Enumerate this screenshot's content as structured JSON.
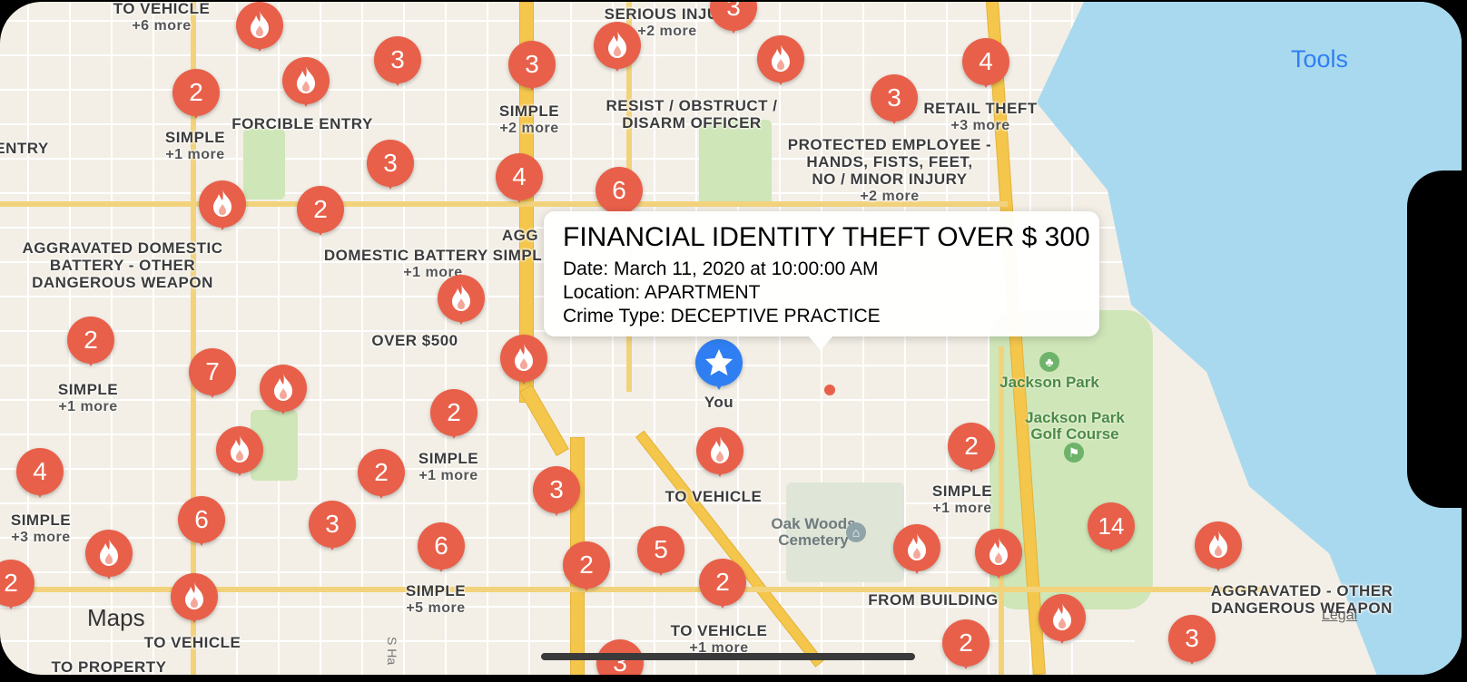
{
  "ui": {
    "tools_label": "Tools",
    "maps_logo": "Maps",
    "legal_label": "Legal"
  },
  "callout": {
    "title": "FINANCIAL IDENTITY THEFT OVER $ 300",
    "date": "Date: March 11, 2020 at 10:00:00 AM",
    "location": "Location: APARTMENT",
    "crime_type": "Crime Type: DECEPTIVE PRACTICE"
  },
  "user_location": {
    "label": "You"
  },
  "places": {
    "jackson_park": "Jackson Park",
    "golf_course": "Jackson Park\nGolf Course",
    "cemetery": "Oak Woods\nCemetery",
    "street_fragment": "S Ha"
  },
  "labels": [
    {
      "text": "TO VEHICLE",
      "more": "+6 more"
    },
    {
      "text": "SERIOUS INJUR",
      "more": "+2 more"
    },
    {
      "text": "SIMPLE",
      "more": "+1 more"
    },
    {
      "text": "FORCIBLE ENTRY",
      "more": ""
    },
    {
      "text": "SIMPLE",
      "more": "+2 more"
    },
    {
      "text": "RESIST / OBSTRUCT /\nDISARM OFFICER",
      "more": ""
    },
    {
      "text": "RETAIL THEFT",
      "more": "+3 more"
    },
    {
      "text": "PROTECTED EMPLOYEE -\nHANDS, FISTS, FEET,\nNO / MINOR INJURY",
      "more": "+2 more"
    },
    {
      "text": "ENTRY",
      "more": ""
    },
    {
      "text": "AGGRAVATED DOMESTIC\nBATTERY - OTHER\nDANGEROUS WEAPON",
      "more": ""
    },
    {
      "text": "DOMESTIC BATTERY SIMPL",
      "more": "+1 more"
    },
    {
      "text": "AGG",
      "more": ""
    },
    {
      "text": "OVER $500",
      "more": ""
    },
    {
      "text": "SIMPLE",
      "more": "+1 more"
    },
    {
      "text": "SIMPLE",
      "more": "+1 more"
    },
    {
      "text": "TO VEHICLE",
      "more": ""
    },
    {
      "text": "SIMPLE",
      "more": "+1 more"
    },
    {
      "text": "SIMPLE",
      "more": "+3 more"
    },
    {
      "text": "SIMPLE",
      "more": "+5 more"
    },
    {
      "text": "FROM BUILDING",
      "more": ""
    },
    {
      "text": "AGGRAVATED - OTHER\nDANGEROUS WEAPON",
      "more": ""
    },
    {
      "text": "TO VEHICLE",
      "more": ""
    },
    {
      "text": "TO VEHICLE",
      "more": "+1 more"
    },
    {
      "text": "TO PROPERTY",
      "more": ""
    }
  ],
  "pins": [
    {
      "kind": "flame"
    },
    {
      "kind": "count",
      "count": "3"
    },
    {
      "kind": "count",
      "count": "2"
    },
    {
      "kind": "flame"
    },
    {
      "kind": "count",
      "count": "3"
    },
    {
      "kind": "count",
      "count": "3"
    },
    {
      "kind": "flame"
    },
    {
      "kind": "flame"
    },
    {
      "kind": "count",
      "count": "4"
    },
    {
      "kind": "count",
      "count": "3"
    },
    {
      "kind": "count",
      "count": "3"
    },
    {
      "kind": "flame"
    },
    {
      "kind": "count",
      "count": "2"
    },
    {
      "kind": "count",
      "count": "4"
    },
    {
      "kind": "count",
      "count": "6"
    },
    {
      "kind": "flame"
    },
    {
      "kind": "count",
      "count": "2"
    },
    {
      "kind": "count",
      "count": "7"
    },
    {
      "kind": "flame"
    },
    {
      "kind": "flame"
    },
    {
      "kind": "count",
      "count": "2"
    },
    {
      "kind": "flame"
    },
    {
      "kind": "count",
      "count": "2"
    },
    {
      "kind": "count",
      "count": "3"
    },
    {
      "kind": "flame"
    },
    {
      "kind": "count",
      "count": "4"
    },
    {
      "kind": "count",
      "count": "6"
    },
    {
      "kind": "count",
      "count": "3"
    },
    {
      "kind": "count",
      "count": "6"
    },
    {
      "kind": "count",
      "count": "2"
    },
    {
      "kind": "count",
      "count": "5"
    },
    {
      "kind": "count",
      "count": "2"
    },
    {
      "kind": "count",
      "count": "2"
    },
    {
      "kind": "flame"
    },
    {
      "kind": "flame"
    },
    {
      "kind": "count",
      "count": "14"
    },
    {
      "kind": "flame"
    },
    {
      "kind": "flame"
    },
    {
      "kind": "flame"
    },
    {
      "kind": "count",
      "count": "2"
    },
    {
      "kind": "flame"
    },
    {
      "kind": "count",
      "count": "3"
    },
    {
      "kind": "count",
      "count": "3"
    },
    {
      "kind": "count",
      "count": "2"
    }
  ],
  "colors": {
    "pin": "#e8604a",
    "user_pin": "#2f7ff2",
    "water": "#a9d9ee",
    "park": "#cfe6b8",
    "highway": "#f5c64c",
    "tools": "#2f7ff2"
  }
}
